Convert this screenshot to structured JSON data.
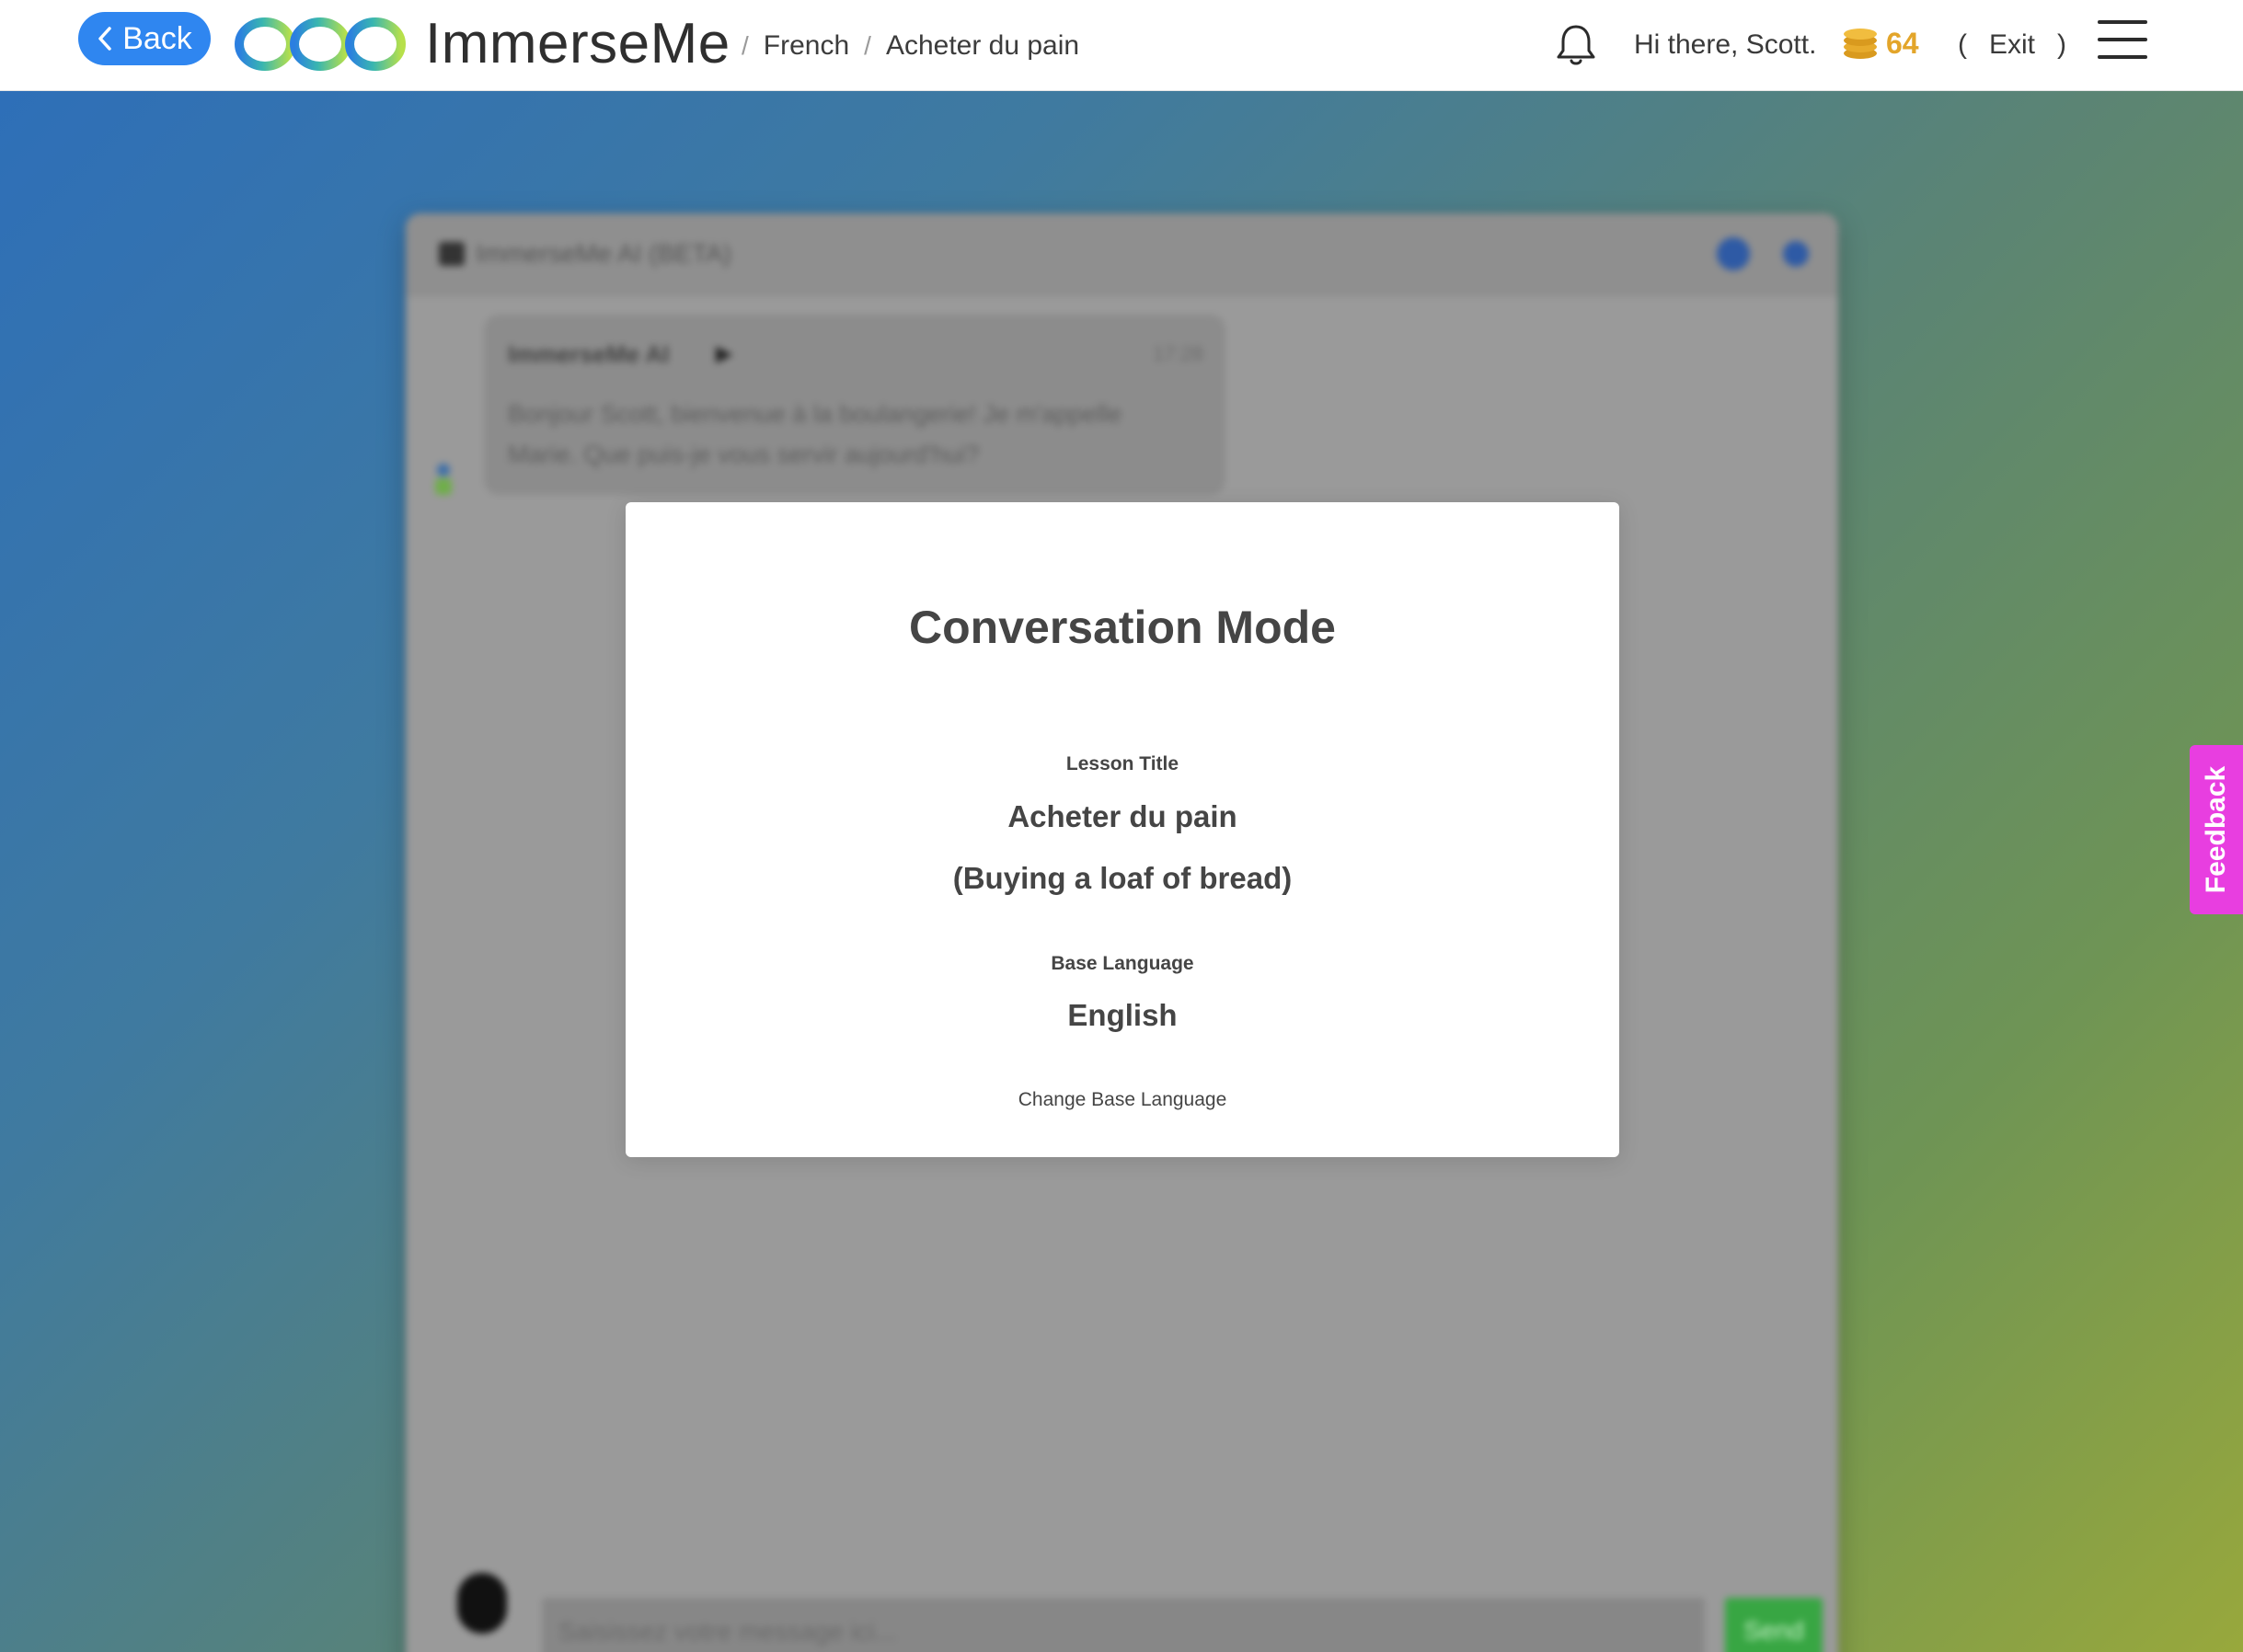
{
  "header": {
    "back_label": "Back",
    "brand": "ImmerseMe",
    "breadcrumb": [
      "French",
      "Acheter du pain"
    ],
    "breadcrumb_separator": "/",
    "greeting": "Hi there, Scott.",
    "coins": "64",
    "exit_open": "(",
    "exit_label": "Exit",
    "exit_close": ")",
    "icons": {
      "back": "chevron-left-icon",
      "logo": "infinity-logo-icon",
      "bell": "bell-icon",
      "coins": "coin-stack-icon",
      "menu": "hamburger-menu-icon"
    }
  },
  "chat": {
    "title": "ImmerseMe AI (BETA)",
    "sender": "ImmerseMe AI",
    "time": "17:28",
    "message": "Bonjour Scott, bienvenue à la boulangerie! Je m'appelle Marie. Que puis-je vous servir aujourd'hui?",
    "input_placeholder": "Saisissez votre message ici...",
    "send_label": "Send"
  },
  "modal": {
    "title": "Conversation Mode",
    "lesson_label": "Lesson Title",
    "lesson_title": "Acheter du pain",
    "lesson_translation": "(Buying a loaf of bread)",
    "base_language_label": "Base Language",
    "base_language": "English",
    "change_link": "Change Base Language"
  },
  "feedback_label": "Feedback",
  "colors": {
    "accent": "#2f86f0",
    "coins": "#e3a52a",
    "feedback": "#e83ee0",
    "link": "#2d7ad6",
    "send": "#38a643"
  }
}
